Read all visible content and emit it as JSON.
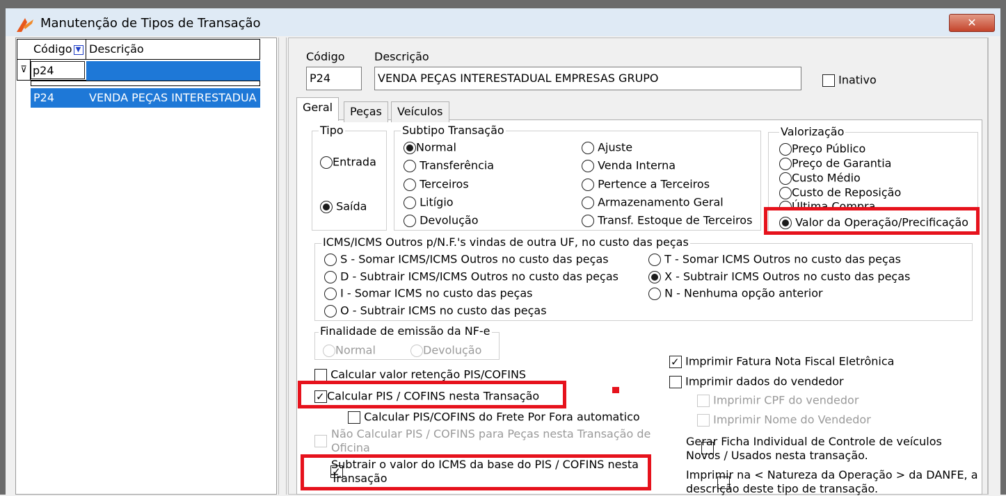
{
  "window": {
    "title": "Manutenção de Tipos de Transação",
    "close_label": "✕",
    "accent": "#1e78d7",
    "highlight": "#e6121c"
  },
  "grid": {
    "col_code": "Código",
    "col_desc": "Descrição",
    "filter_value": "p24",
    "rows": [
      {
        "code": "P24",
        "desc": "VENDA PEÇAS INTERESTADUA"
      }
    ]
  },
  "form": {
    "code_label": "Código",
    "desc_label": "Descrição",
    "code_value": "P24",
    "desc_value": "VENDA PEÇAS INTERESTADUAL EMPRESAS GRUPO",
    "inactive_label": "Inativo"
  },
  "tabs": [
    "Geral",
    "Peças",
    "Veículos"
  ],
  "tipo": {
    "legend": "Tipo",
    "options": [
      "Entrada",
      "Saída"
    ]
  },
  "subtipo": {
    "legend": "Subtipo Transação",
    "col1": [
      "Normal",
      "Transferência",
      "Terceiros",
      "Litígio",
      "Devolução"
    ],
    "col2": [
      "Ajuste",
      "Venda Interna",
      "Pertence a Terceiros",
      "Armazenamento Geral",
      "Transf. Estoque de Terceiros"
    ]
  },
  "valorizacao": {
    "legend": "Valorização",
    "options": [
      "Preço Público",
      "Preço de Garantia",
      "Custo Médio",
      "Custo de Reposição",
      "Última Compra",
      "Valor da Operação/Precificação"
    ]
  },
  "icms": {
    "legend": "ICMS/ICMS Outros p/N.F.'s vindas de outra UF, no custo das peças",
    "col1": [
      "S - Somar ICMS/ICMS Outros no custo das peças",
      "D - Subtrair ICMS/ICMS Outros no custo das peças",
      "I - Somar ICMS no custo das peças",
      "O - Subtrair ICMS no custo das peças"
    ],
    "col2": [
      "T - Somar ICMS Outros no custo das peças",
      "X - Subtrair ICMS Outros no custo das peças",
      "N - Nenhuma opção anterior"
    ]
  },
  "finalidade": {
    "legend": "Finalidade de emissão da NF-e",
    "options": [
      "Normal",
      "Devolução"
    ]
  },
  "checks_left": {
    "calc_retencao": "Calcular valor retenção PIS/COFINS",
    "calc_pis": "Calcular PIS / COFINS nesta Transação",
    "calc_frete": "Calcular PIS/COFINS do Frete Por Fora automatico",
    "nao_calc": "Não Calcular PIS / COFINS para Peças nesta Transação de Oficina",
    "subtrair_icms": "Subtrair o valor do ICMS da base do PIS / COFINS nesta Transação"
  },
  "checks_right": {
    "imprimir_fatura": "Imprimir Fatura Nota Fiscal Eletrônica",
    "imprimir_vendedor": "Imprimir dados do vendedor",
    "imprimir_cpf": "Imprimir CPF do vendedor",
    "imprimir_nome": "Imprimir Nome do Vendedor",
    "gerar_ficha": "Gerar Ficha Individual de Controle de veículos Novos / Usados  nesta transação.",
    "imprimir_natureza": "Imprimir na < Natureza da Operação > da DANFE, a descrição deste tipo de transação."
  }
}
